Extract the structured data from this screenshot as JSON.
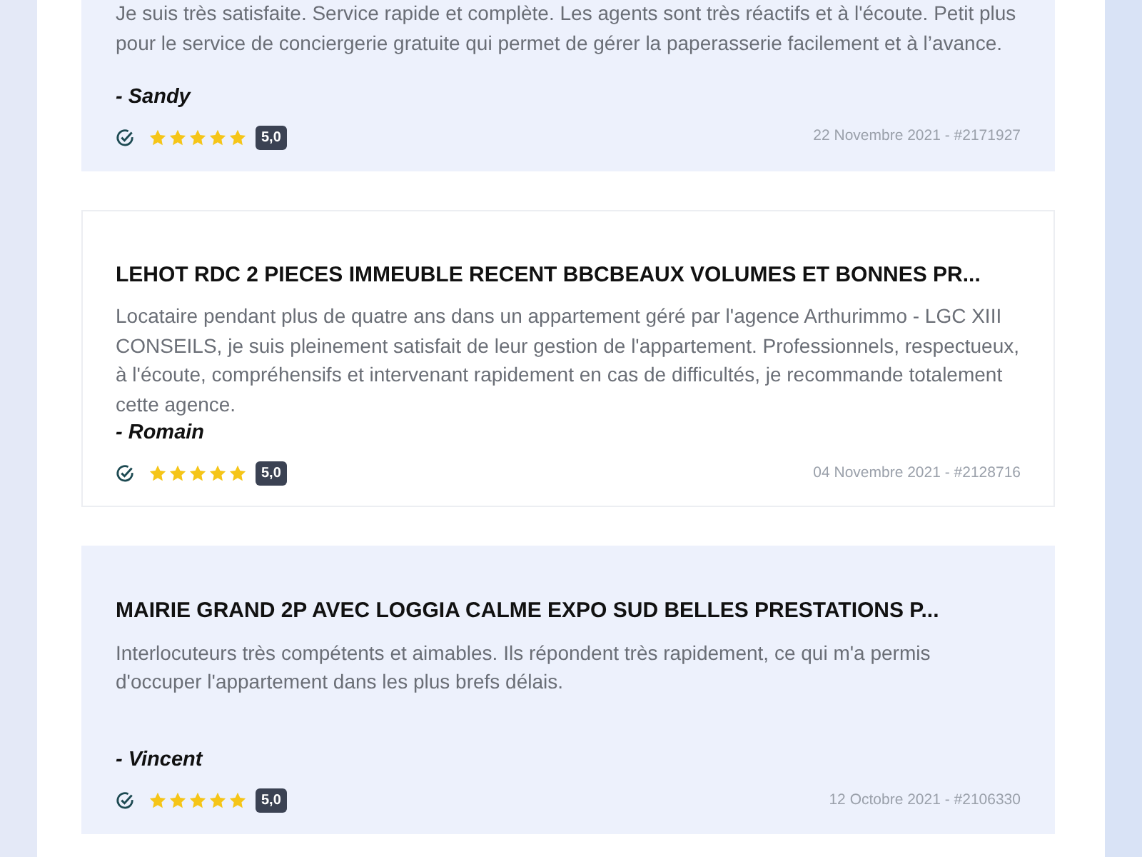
{
  "reviews": [
    {
      "highlighted": true,
      "text": "Je suis très satisfaite. Service rapide et complète. Les agents sont très réactifs et à l'écoute. Petit plus pour le service de conciergerie gratuite qui permet de gérer la paperasserie facilement et à l’avance.",
      "author": "- Sandy",
      "verified": true,
      "stars": 5,
      "score": "5,0",
      "meta": "22 Novembre 2021 - #2171927"
    },
    {
      "highlighted": false,
      "title": "LEHOT RDC 2 PIECES IMMEUBLE RECENT BBCBEAUX VOLUMES ET BONNES PR...",
      "text": "Locataire pendant plus de quatre ans dans un appartement géré par l'agence Arthurimmo - LGC XIII CONSEILS, je suis pleinement satisfait de leur gestion de l'appartement. Professionnels, respectueux, à l'écoute, compréhensifs et intervenant rapidement en cas de difficultés, je recommande totalement cette agence.",
      "author": "- Romain",
      "verified": true,
      "stars": 5,
      "score": "5,0",
      "meta": "04 Novembre 2021 - #2128716"
    },
    {
      "highlighted": true,
      "title": "MAIRIE GRAND 2P AVEC LOGGIA CALME EXPO SUD BELLES PRESTATIONS P...",
      "text": "Interlocuteurs très compétents et aimables. Ils répondent très rapidement, ce qui m'a permis d'occuper l'appartement dans les plus brefs délais.",
      "author": "- Vincent",
      "verified": true,
      "stars": 5,
      "score": "5,0",
      "meta": "12 Octobre 2021 - #2106330"
    }
  ]
}
